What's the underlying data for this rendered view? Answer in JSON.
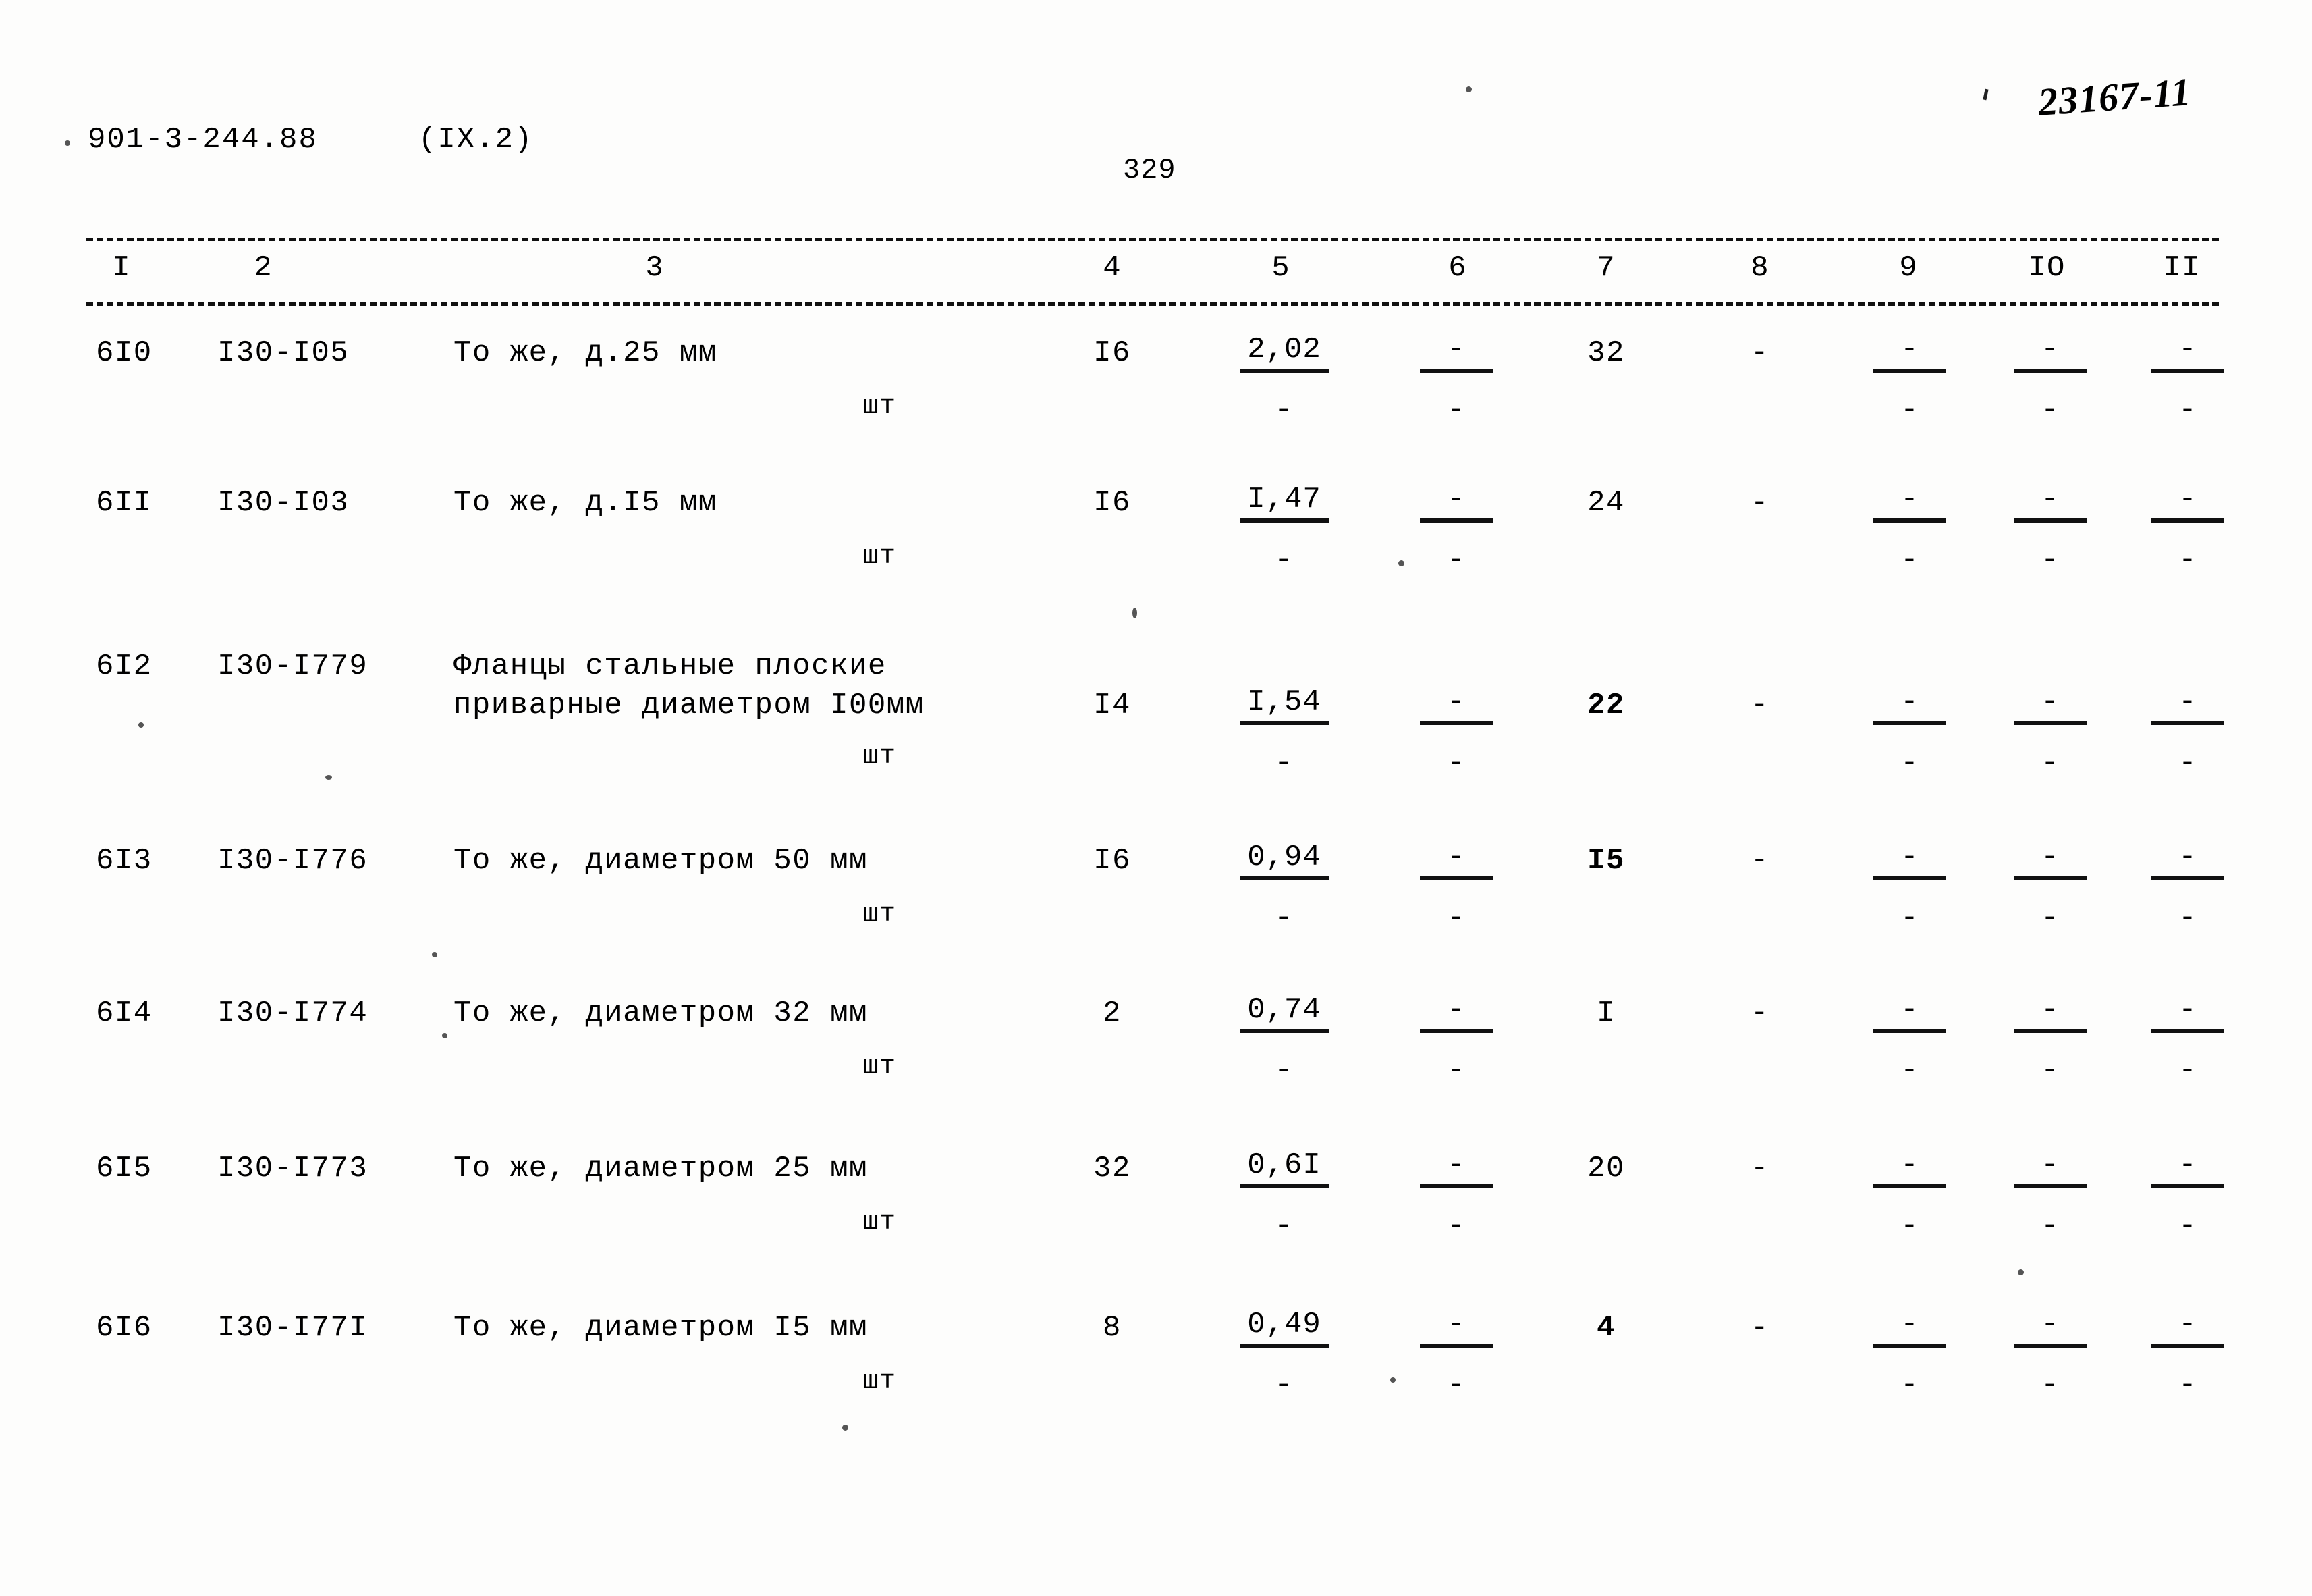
{
  "header": {
    "doc_code": "901-3-244.88",
    "section": "(IX.2)",
    "page_number": "329",
    "archive_mark": "23167-11"
  },
  "table": {
    "column_headers": [
      "I",
      "2",
      "3",
      "4",
      "5",
      "6",
      "7",
      "8",
      "9",
      "IO",
      "II"
    ],
    "unit_label": "шт",
    "rows": [
      {
        "num": "6I0",
        "code": "I30-I05",
        "desc1": "То же, д.25 мм",
        "desc2": "",
        "unit": "шт",
        "c4": "I6",
        "c5_num": "2,02",
        "c5_den": "-",
        "c6_num": "-",
        "c6_den": "-",
        "c7": "32",
        "c8": "-",
        "c9_num": "-",
        "c9_den": "-",
        "c10_num": "-",
        "c10_den": "-",
        "c11_num": "-",
        "c11_den": "-"
      },
      {
        "num": "6II",
        "code": "I30-I03",
        "desc1": "То же, д.I5 мм",
        "desc2": "",
        "unit": "шт",
        "c4": "I6",
        "c5_num": "I,47",
        "c5_den": "-",
        "c6_num": "-",
        "c6_den": "-",
        "c7": "24",
        "c8": "-",
        "c9_num": "-",
        "c9_den": "-",
        "c10_num": "-",
        "c10_den": "-",
        "c11_num": "-",
        "c11_den": "-"
      },
      {
        "num": "6I2",
        "code": "I30-I779",
        "desc1": "Фланцы стальные плоские",
        "desc2": "приварные диаметром I00мм",
        "unit": "шт",
        "c4": "I4",
        "c5_num": "I,54",
        "c5_den": "-",
        "c6_num": "-",
        "c6_den": "-",
        "c7": "22",
        "c8": "-",
        "c9_num": "-",
        "c9_den": "-",
        "c10_num": "-",
        "c10_den": "-",
        "c11_num": "-",
        "c11_den": "-"
      },
      {
        "num": "6I3",
        "code": "I30-I776",
        "desc1": "То же, диаметром 50 мм",
        "desc2": "",
        "unit": "шт",
        "c4": "I6",
        "c5_num": "0,94",
        "c5_den": "-",
        "c6_num": "-",
        "c6_den": "-",
        "c7": "I5",
        "c8": "-",
        "c9_num": "-",
        "c9_den": "-",
        "c10_num": "-",
        "c10_den": "-",
        "c11_num": "-",
        "c11_den": "-"
      },
      {
        "num": "6I4",
        "code": "I30-I774",
        "desc1": "То же, диаметром 32 мм",
        "desc2": "",
        "unit": "шт",
        "c4": "2",
        "c5_num": "0,74",
        "c5_den": "-",
        "c6_num": "-",
        "c6_den": "-",
        "c7": "I",
        "c8": "-",
        "c9_num": "-",
        "c9_den": "-",
        "c10_num": "-",
        "c10_den": "-",
        "c11_num": "-",
        "c11_den": "-"
      },
      {
        "num": "6I5",
        "code": "I30-I773",
        "desc1": "То же, диаметром 25 мм",
        "desc2": "",
        "unit": "шт",
        "c4": "32",
        "c5_num": "0,6I",
        "c5_den": "-",
        "c6_num": "-",
        "c6_den": "-",
        "c7": "20",
        "c8": "-",
        "c9_num": "-",
        "c9_den": "-",
        "c10_num": "-",
        "c10_den": "-",
        "c11_num": "-",
        "c11_den": "-"
      },
      {
        "num": "6I6",
        "code": "I30-I77I",
        "desc1": "То же, диаметром I5 мм",
        "desc2": "",
        "unit": "шт",
        "c4": "8",
        "c5_num": "0,49",
        "c5_den": "-",
        "c6_num": "-",
        "c6_den": "-",
        "c7": "4",
        "c8": "-",
        "c9_num": "-",
        "c9_den": "-",
        "c10_num": "-",
        "c10_den": "-",
        "c11_num": "-",
        "c11_den": "-"
      }
    ]
  }
}
